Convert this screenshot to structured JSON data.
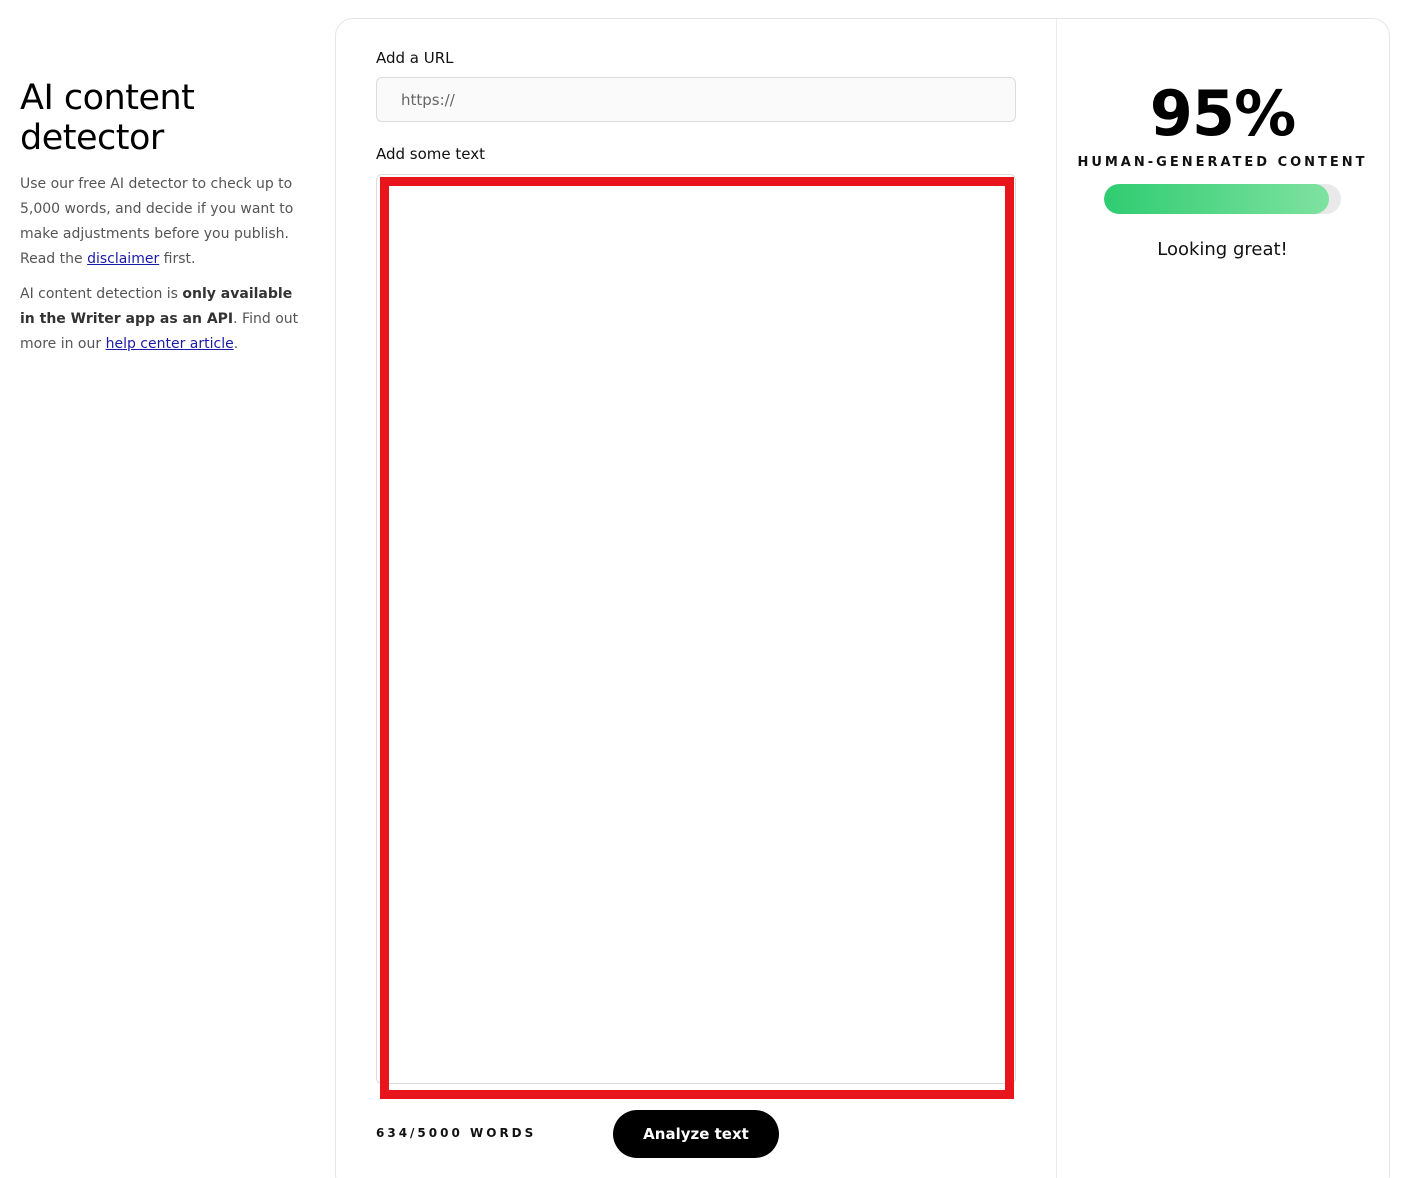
{
  "intro": {
    "title": "AI content detector",
    "paragraph1_prefix": "Use our free AI detector to check up to 5,000 words, and decide if you want to make adjustments before you publish. Read the ",
    "disclaimer_link": "disclaimer",
    "paragraph1_suffix": " first.",
    "paragraph2_prefix": "AI content detection is ",
    "paragraph2_bold": "only available in the Writer app as an API",
    "paragraph2_middle": ". Find out more in our ",
    "help_link": "help center article",
    "paragraph2_suffix": "."
  },
  "form": {
    "url_label": "Add a URL",
    "url_placeholder": "https://",
    "url_value": "",
    "text_label": "Add some text",
    "word_count": "634/5000 WORDS",
    "analyze_button": "Analyze text"
  },
  "result": {
    "score": "95%",
    "score_fraction": 0.95,
    "label": "HUMAN-GENERATED CONTENT",
    "verdict": "Looking great!"
  },
  "colors": {
    "highlight_box": "#e8161c",
    "progress_start": "#2ecc71",
    "progress_end": "#7fe2a0",
    "button_bg": "#000000"
  }
}
